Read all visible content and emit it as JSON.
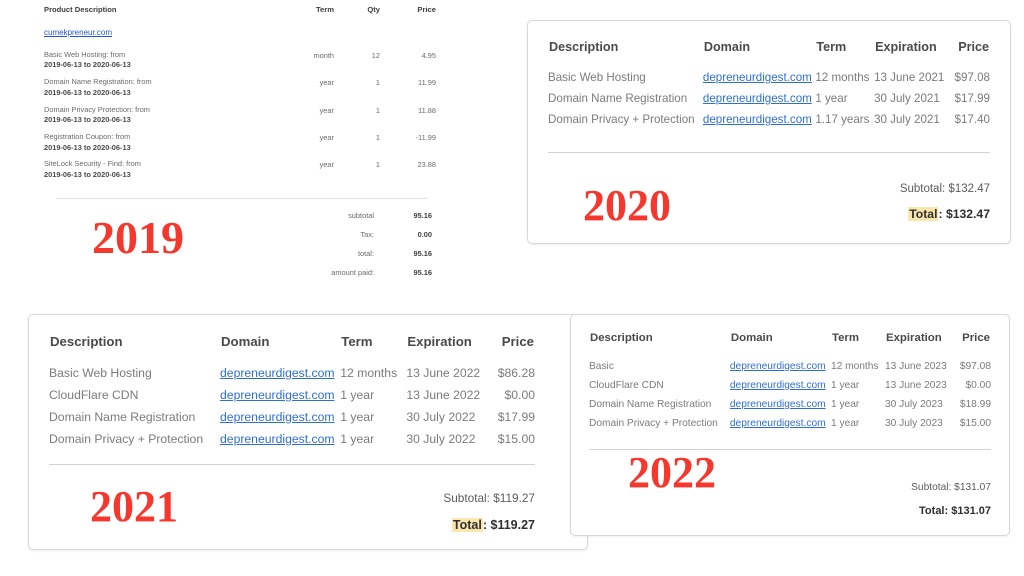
{
  "invoices": [
    {
      "year_label": "2019",
      "style": "legacy",
      "columns": [
        "Product Description",
        "Term",
        "Qty",
        "Price"
      ],
      "domain_link": "cumekpreneur.com",
      "rows": [
        {
          "description": "Basic Web Hosting: from",
          "dates": "2019-06-13 to 2020-06-13",
          "term": "month",
          "qty": "12",
          "price": "4.95"
        },
        {
          "description": "Domain Name Registration: from",
          "dates": "2019-06-13 to 2020-06-13",
          "term": "year",
          "qty": "1",
          "price": "11.99"
        },
        {
          "description": "Domain Privacy Protection: from",
          "dates": "2019-06-13 to 2020-06-13",
          "term": "year",
          "qty": "1",
          "price": "11.88"
        },
        {
          "description": "Registration Coupon: from",
          "dates": "2019-06-13 to 2020-06-13",
          "term": "year",
          "qty": "1",
          "price": "-11.99"
        },
        {
          "description": "SiteLock Security - Find: from",
          "dates": "2019-06-13 to 2020-06-13",
          "term": "year",
          "qty": "1",
          "price": "23.88"
        }
      ],
      "totals": [
        {
          "label": "subtotal",
          "value": "95.16"
        },
        {
          "label": "Tax:",
          "value": "0.00"
        },
        {
          "label": "total:",
          "value": "95.16"
        },
        {
          "label": "amount paid:",
          "value": "95.16"
        }
      ]
    },
    {
      "year_label": "2020",
      "style": "card",
      "columns": [
        "Description",
        "Domain",
        "Term",
        "Expiration",
        "Price"
      ],
      "rows": [
        {
          "description": "Basic Web Hosting",
          "domain": "depreneurdigest.com",
          "term": "12 months",
          "expiration": "13 June 2021",
          "price": "$97.08"
        },
        {
          "description": "Domain Name Registration",
          "domain": "depreneurdigest.com",
          "term": "1 year",
          "expiration": "30 July 2021",
          "price": "$17.99"
        },
        {
          "description": "Domain Privacy + Protection",
          "domain": "depreneurdigest.com",
          "term": "1.17 years",
          "expiration": "30 July 2021",
          "price": "$17.40"
        }
      ],
      "subtotal_label": "Subtotal:",
      "subtotal_value": "$132.47",
      "total_label": "Total",
      "total_value": "$132.47",
      "total_highlighted": true
    },
    {
      "year_label": "2021",
      "style": "card",
      "columns": [
        "Description",
        "Domain",
        "Term",
        "Expiration",
        "Price"
      ],
      "rows": [
        {
          "description": "Basic Web Hosting",
          "domain": "depreneurdigest.com",
          "term": "12 months",
          "expiration": "13 June 2022",
          "price": "$86.28"
        },
        {
          "description": "CloudFlare CDN",
          "domain": "depreneurdigest.com",
          "term": "1 year",
          "expiration": "13 June 2022",
          "price": "$0.00"
        },
        {
          "description": "Domain Name Registration",
          "domain": "depreneurdigest.com",
          "term": "1 year",
          "expiration": "30 July 2022",
          "price": "$17.99"
        },
        {
          "description": "Domain Privacy + Protection",
          "domain": "depreneurdigest.com",
          "term": "1 year",
          "expiration": "30 July 2022",
          "price": "$15.00"
        }
      ],
      "subtotal_label": "Subtotal:",
      "subtotal_value": "$119.27",
      "total_label": "Total",
      "total_value": "$119.27",
      "total_highlighted": true
    },
    {
      "year_label": "2022",
      "style": "card",
      "columns": [
        "Description",
        "Domain",
        "Term",
        "Expiration",
        "Price"
      ],
      "rows": [
        {
          "description": "Basic",
          "domain": "depreneurdigest.com",
          "term": "12 months",
          "expiration": "13 June 2023",
          "price": "$97.08"
        },
        {
          "description": "CloudFlare CDN",
          "domain": "depreneurdigest.com",
          "term": "1 year",
          "expiration": "13 June 2023",
          "price": "$0.00"
        },
        {
          "description": "Domain Name Registration",
          "domain": "depreneurdigest.com",
          "term": "1 year",
          "expiration": "30 July 2023",
          "price": "$18.99"
        },
        {
          "description": "Domain Privacy + Protection",
          "domain": "depreneurdigest.com",
          "term": "1 year",
          "expiration": "30 July 2023",
          "price": "$15.00"
        }
      ],
      "subtotal_label": "Subtotal:",
      "subtotal_value": "$131.07",
      "total_label": "Total",
      "total_value": "$131.07",
      "total_highlighted": false
    }
  ],
  "colors": {
    "year_stamp": "#f5372d",
    "link": "#2f6fd0",
    "highlight": "#fbe7ae",
    "background": "#ffffff",
    "card_border": "#d8d8d8"
  }
}
